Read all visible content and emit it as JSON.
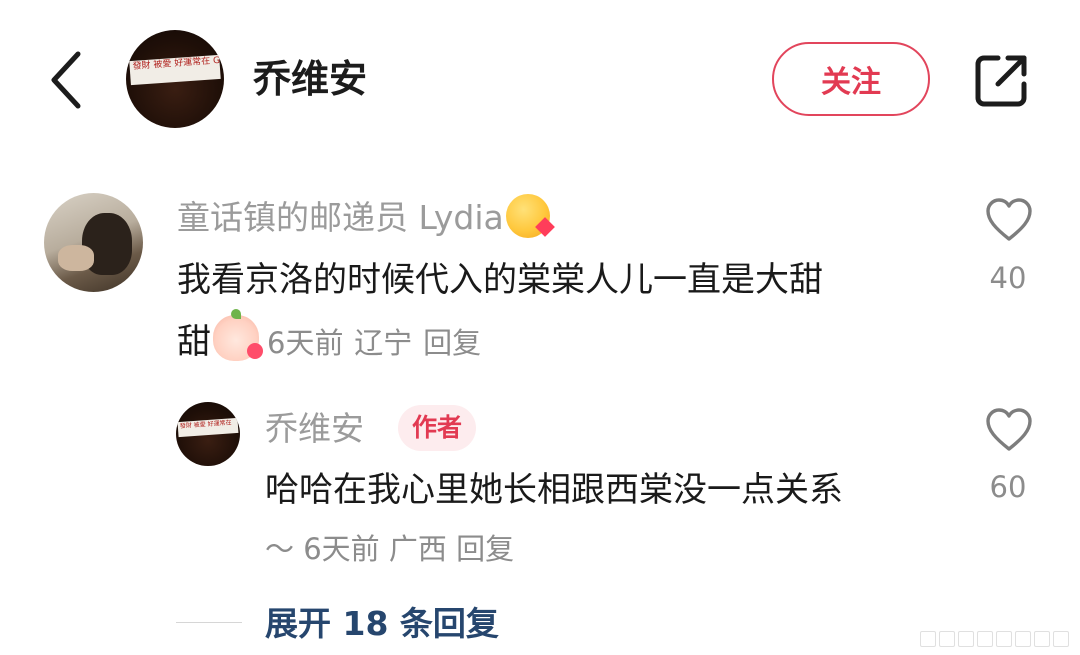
{
  "header": {
    "back_icon": "chevron-left-icon",
    "author_name": "乔维安",
    "avatar_text": "發財 被愛 好運常在 Getting rich is often a hobby",
    "follow_label": "关注",
    "share_icon": "share-external-icon",
    "accent_color": "#e23a52"
  },
  "comment": {
    "username": "童话镇的邮递员 Lydia",
    "username_emoji": "kissing-face-emoji",
    "text": "我看京洛的时候代入的棠棠人儿一直是大甜",
    "text_tail": "甜",
    "text_emoji": "blush-kiss-emoji",
    "time": "6天前",
    "location": "辽宁",
    "reply_label": "回复",
    "likes": "40"
  },
  "reply": {
    "username": "乔维安",
    "badge": "作者",
    "avatar_text": "發財 被愛 好運常在",
    "text": "哈哈在我心里她长相跟西棠没一点关系",
    "tilde": "〜",
    "time": "6天前",
    "location": "广西",
    "reply_label": "回复",
    "likes": "60"
  },
  "expand_label": "展开 18 条回复"
}
